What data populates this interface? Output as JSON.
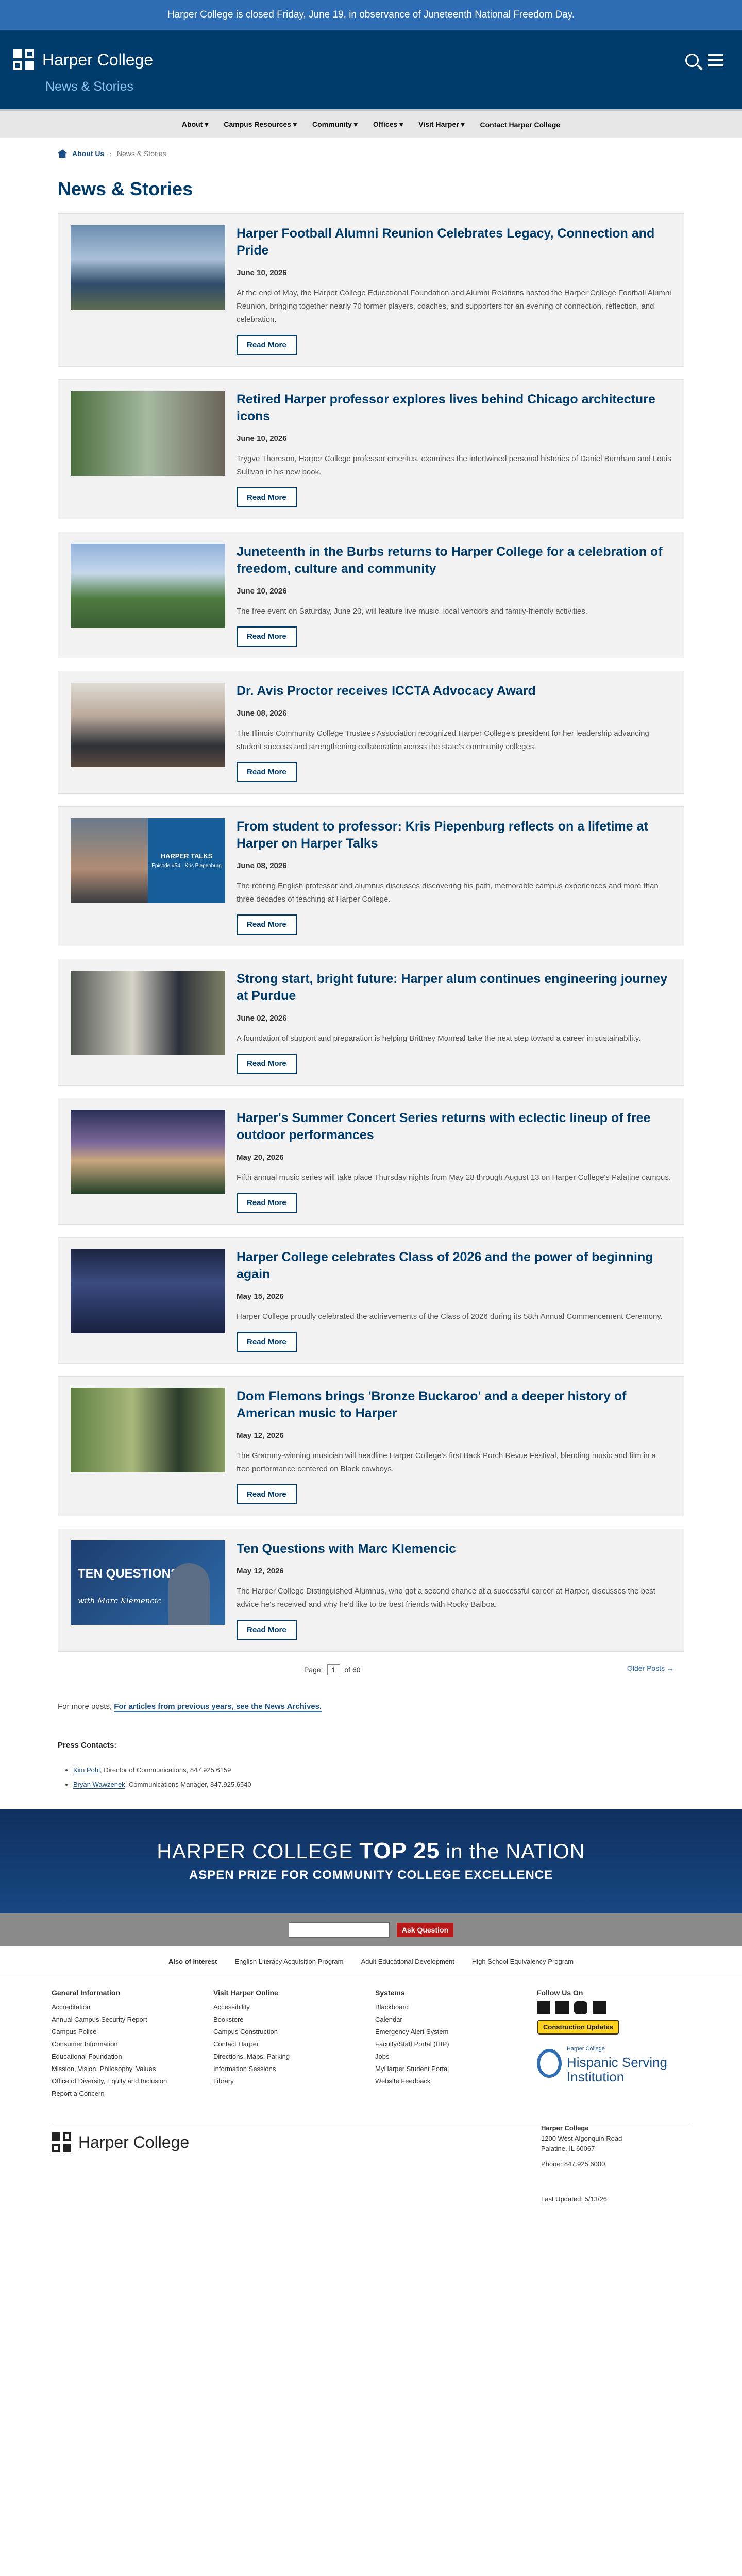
{
  "alert": "Harper College is closed Friday, June 19, in observance of Juneteenth National Freedom Day.",
  "header": {
    "logo_text": "Harper College",
    "site_name": "News & Stories"
  },
  "nav": [
    "About ▾",
    "Campus Resources ▾",
    "Community ▾",
    "Offices ▾",
    "Visit Harper ▾",
    "Contact Harper College"
  ],
  "breadcrumb": {
    "parent": "About Us",
    "sep": "›",
    "current": "News & Stories"
  },
  "page_title": "News & Stories",
  "posts": [
    {
      "title": "Harper Football Alumni Reunion Celebrates Legacy, Connection and Pride",
      "date": "June 10, 2026",
      "excerpt": "At the end of May, the Harper College Educational Foundation and Alumni Relations hosted the Harper College Football Alumni Reunion, bringing together nearly 70 former players, coaches, and supporters for an evening of connection, reflection, and celebration.",
      "button": "Read More"
    },
    {
      "title": "Retired Harper professor explores lives behind Chicago architecture icons",
      "date": "June 10, 2026",
      "excerpt": "Trygve Thoreson, Harper College professor emeritus, examines the intertwined personal histories of Daniel Burnham and Louis Sullivan in his new book.",
      "button": "Read More"
    },
    {
      "title": "Juneteenth in the Burbs returns to Harper College for a celebration of freedom, culture and community",
      "date": "June 10, 2026",
      "excerpt": "The free event on Saturday, June 20, will feature live music, local vendors and family-friendly activities.",
      "button": "Read More"
    },
    {
      "title": "Dr. Avis Proctor receives ICCTA Advocacy Award",
      "date": "June 08, 2026",
      "excerpt": "The Illinois Community College Trustees Association recognized Harper College's president for her leadership advancing student success and strengthening collaboration across the state's community colleges.",
      "button": "Read More"
    },
    {
      "title": "From student to professor: Kris Piepenburg reflects on a lifetime at Harper on Harper Talks",
      "date": "June 08, 2026",
      "excerpt": "The retiring English professor and alumnus discusses discovering his path, memorable campus experiences and more than three decades of teaching at Harper College.",
      "button": "Read More",
      "badge_title": "HARPER TALKS",
      "badge_sub": "Episode #54 · Kris Piepenburg"
    },
    {
      "title": "Strong start, bright future: Harper alum continues engineering journey at Purdue",
      "date": "June 02, 2026",
      "excerpt": "A foundation of support and preparation is helping Brittney Monreal take the next step toward a career in sustainability.",
      "button": "Read More"
    },
    {
      "title": "Harper's Summer Concert Series returns with eclectic lineup of free outdoor performances",
      "date": "May 20, 2026",
      "excerpt": "Fifth annual music series will take place Thursday nights from May 28 through August 13 on Harper College's Palatine campus.",
      "button": "Read More"
    },
    {
      "title": "Harper College celebrates Class of 2026 and the power of beginning again",
      "date": "May 15, 2026",
      "excerpt": "Harper College proudly celebrated the achievements of the Class of 2026 during its 58th Annual Commencement Ceremony.",
      "button": "Read More"
    },
    {
      "title": "Dom Flemons brings 'Bronze Buckaroo' and a deeper history of American music to Harper",
      "date": "May 12, 2026",
      "excerpt": "The Grammy-winning musician will headline Harper College's first Back Porch Revue Festival, blending music and film in a free performance centered on Black cowboys.",
      "button": "Read More"
    },
    {
      "title": "Ten Questions with Marc Klemencic",
      "date": "May 12, 2026",
      "excerpt": "The Harper College Distinguished Alumnus, who got a second chance at a successful career at Harper, discusses the best advice he's received and why he'd like to be best friends with Rocky Balboa.",
      "button": "Read More",
      "badge_title": "TEN QUESTIONS",
      "badge_sub": "with Marc Klemencic"
    }
  ],
  "pager": {
    "label": "Page:",
    "current": "1",
    "of": "of 60",
    "older": "Older Posts →"
  },
  "formore": {
    "text": "For more posts,",
    "link": "For articles from previous years, see the News Archives."
  },
  "press": {
    "title": "Press Contacts:",
    "contacts": [
      {
        "name": "Kim Pohl",
        "role": ", Director of Communications, 847.925.6159"
      },
      {
        "name": "Bryan Wawzenek",
        "role": ", Communications Manager, 847.925.6540"
      }
    ]
  },
  "aspen": {
    "line1a": "HARPER COLLEGE ",
    "line1b": "TOP 25",
    "line1c": " in the NATION",
    "line2": "ASPEN PRIZE FOR COMMUNITY COLLEGE EXCELLENCE"
  },
  "ask_button": "Ask Question",
  "also": {
    "label": "Also of Interest",
    "links": [
      "English Literacy Acquisition Program",
      "Adult Educational Development",
      "High School Equivalency Program"
    ]
  },
  "footer_cols": [
    {
      "title": "General Information",
      "links": [
        "Accreditation",
        "Annual Campus Security Report",
        "Campus Police",
        "Consumer Information",
        "Educational Foundation",
        "Mission, Vision, Philosophy, Values",
        "Office of Diversity, Equity and Inclusion",
        "Report a Concern"
      ]
    },
    {
      "title": "Visit Harper Online",
      "links": [
        "Accessibility",
        "Bookstore",
        "Campus Construction",
        "Contact Harper",
        "Directions, Maps, Parking",
        "Information Sessions",
        "Library"
      ]
    },
    {
      "title": "Systems",
      "links": [
        "Blackboard",
        "Calendar",
        "Emergency Alert System",
        "Faculty/Staff Portal (HIP)",
        "Jobs",
        "MyHarper Student Portal",
        "Website Feedback"
      ]
    }
  ],
  "follow": {
    "title": "Follow Us On",
    "construction": "Construction Updates",
    "hsi_small": "Harper College",
    "hsi_big": "Hispanic Serving Institution"
  },
  "footer_bottom": {
    "logo": "Harper College",
    "addr_name": "Harper College",
    "addr1": "1200 West Algonquin Road",
    "addr2": "Palatine, IL 60067",
    "phone": "Phone: 847.925.6000",
    "updated": "Last Updated: 5/13/26"
  },
  "colors": {
    "brand": "#003c6b",
    "accent": "#2e6db4",
    "ask": "#b81919",
    "construction": "#ffd21f"
  }
}
